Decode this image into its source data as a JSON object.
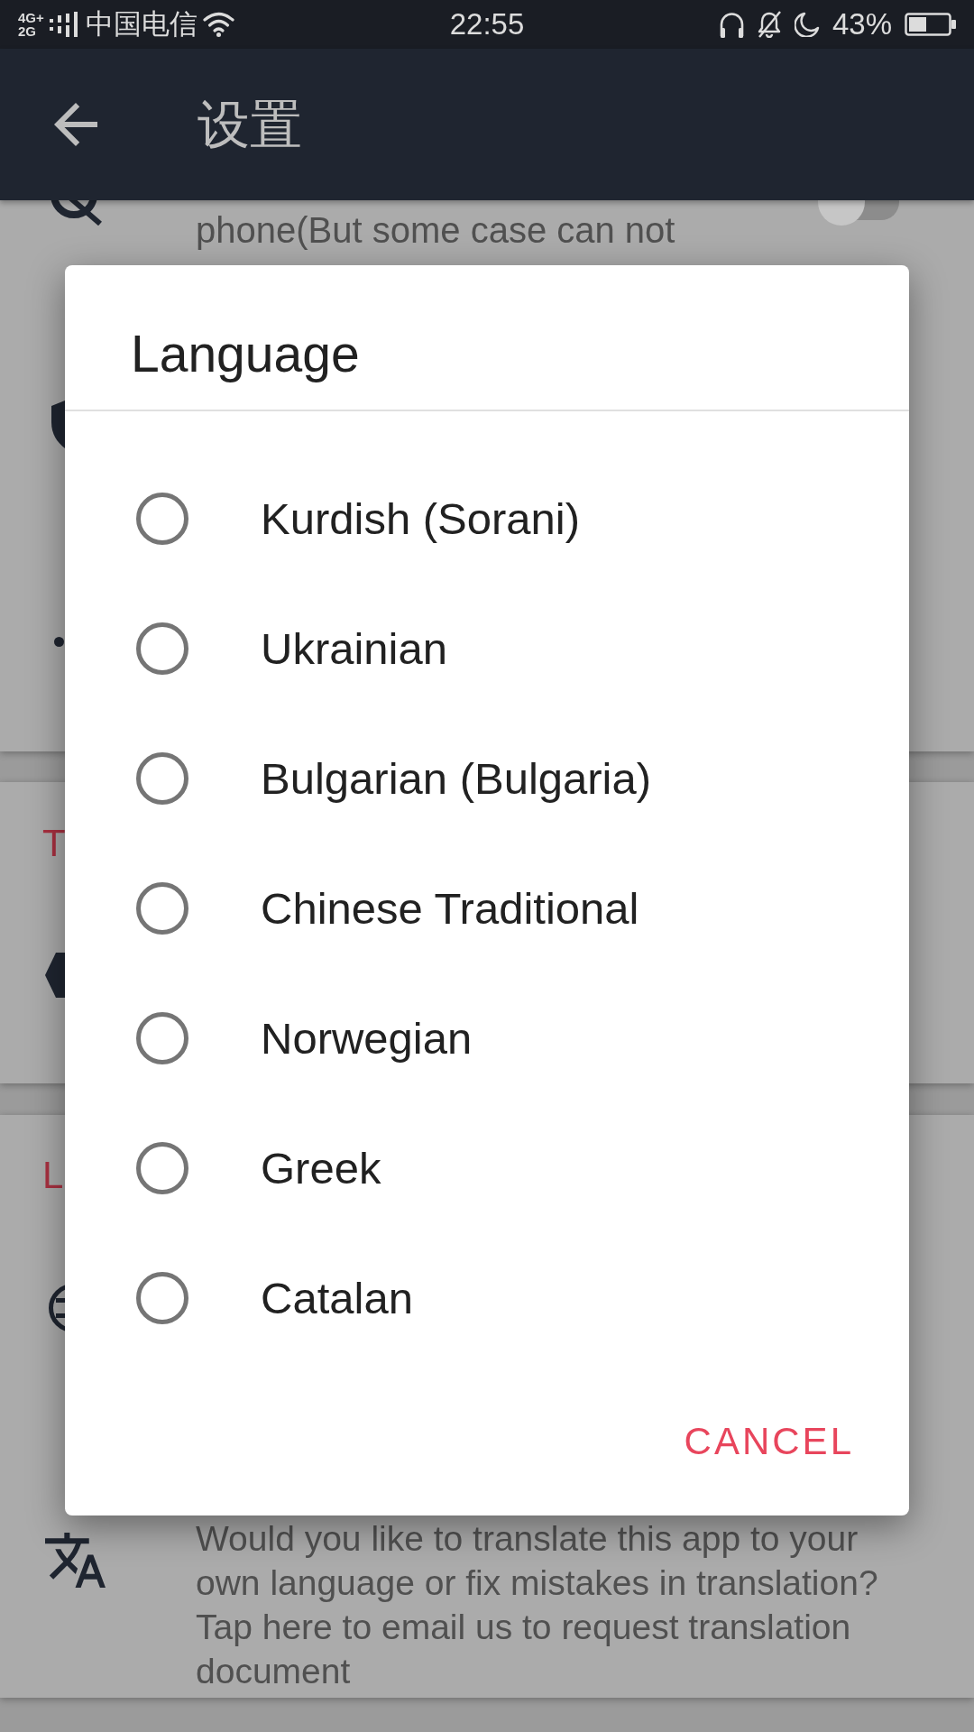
{
  "status_bar": {
    "network_top": "4G+",
    "network_bottom": "2G",
    "carrier": "中国电信",
    "time": "22:55",
    "battery": "43%"
  },
  "app_bar": {
    "title": "设置"
  },
  "settings_cards": [
    {
      "kind": "toggle_card",
      "description": "phone(But some case can not",
      "on": false
    },
    {
      "kind": "tag_section",
      "header": "T"
    },
    {
      "kind": "language_section",
      "header": "L",
      "description": "Would you like to translate this app to your own language or fix mistakes in translation? Tap here to email us to request translation document"
    }
  ],
  "dialog": {
    "title": "Language",
    "options": [
      {
        "label": "Kurdish (Sorani)",
        "selected": false
      },
      {
        "label": "Ukrainian",
        "selected": false
      },
      {
        "label": "Bulgarian (Bulgaria)",
        "selected": false
      },
      {
        "label": "Chinese Traditional",
        "selected": false
      },
      {
        "label": "Norwegian",
        "selected": false
      },
      {
        "label": "Greek",
        "selected": false
      },
      {
        "label": "Catalan",
        "selected": false
      }
    ],
    "cancel": "CANCEL"
  }
}
